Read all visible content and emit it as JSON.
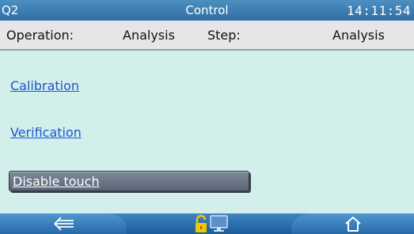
{
  "titlebar": {
    "device": "Q2",
    "title": "Control",
    "time": "14:11:54"
  },
  "status": {
    "operation_label": "Operation:",
    "operation_value": "Analysis",
    "step_label": "Step:",
    "step_value": "Analysis"
  },
  "links": {
    "calibration": "Calibration",
    "verification": "Verification"
  },
  "buttons": {
    "disable_touch": "Disable touch"
  },
  "navbar": {
    "icons": [
      "back-arrow-icon",
      "lock-open-icon",
      "monitor-icon",
      "home-icon"
    ]
  },
  "colors": {
    "title_bar": "#2f6ea5",
    "link": "#1f56c8",
    "background": "#d2efec",
    "lock": "#f5c400"
  }
}
